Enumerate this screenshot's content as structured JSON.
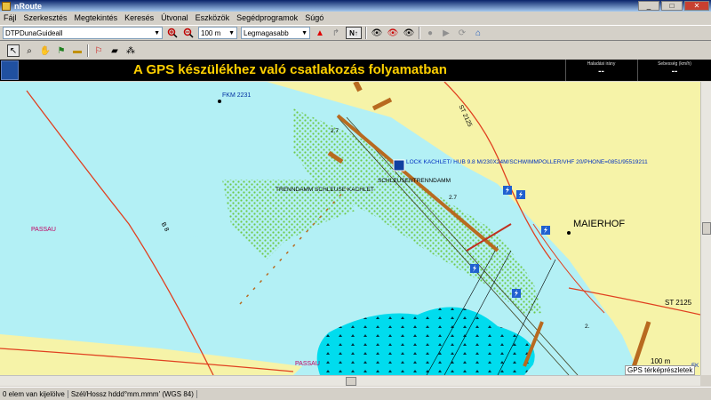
{
  "window": {
    "title": "nRoute",
    "controls": {
      "minimize": "_",
      "maximize": "□",
      "close": "✕"
    }
  },
  "menu": [
    "Fájl",
    "Szerkesztés",
    "Megtekintés",
    "Keresés",
    "Útvonal",
    "Eszközök",
    "Segédprogramok",
    "Súgó"
  ],
  "toolbar": {
    "map_select": "DTPDunaGuideall",
    "zoom_select": "100 m",
    "detail_select": "Legmagasabb",
    "north_up": "N↑"
  },
  "banner": {
    "message": "A GPS készülékhez való csatlakozás folyamatban",
    "box1_label": "Haladási irány",
    "box1_value": "--",
    "box2_label": "Sebesség (km/h)",
    "box2_value": "--"
  },
  "map": {
    "labels": {
      "fkm": "FKM 2231",
      "passau1": "PASSAU",
      "passau2": "PASSAU",
      "b8": "B 8",
      "st2125_top": "ST 2125",
      "st2125_right": "ST 2125",
      "maierhof": "MAIERHOF",
      "lock": "LOCK KACHLET/ HUB 9.8 M/230X24M/SCHWIMMPOLLER/VHF 20/PHONE=0851/95519211",
      "schleuse": "SCHLEUSENTRENNDAMM",
      "trenndamm": "TRENNDAMM SCHLEUSE KACHLET",
      "depth1": "2.7",
      "depth2": "2.7",
      "depth3": "2.",
      "fk": "FK"
    },
    "scale": "100 m",
    "gps_tag": "GPS térképrészletek"
  },
  "statusbar": {
    "selection": "0 elem van kijelölve",
    "coords_format": "Szél/Hossz hddd°mm.mmm' (WGS 84)"
  },
  "colors": {
    "land": "#f6f3a8",
    "water": "#b3f0f5",
    "deep_water": "#00e0f0",
    "vegetation": "#78d050",
    "structure": "#b86a20",
    "road": "#e04020",
    "banner_text": "#ffd000"
  }
}
